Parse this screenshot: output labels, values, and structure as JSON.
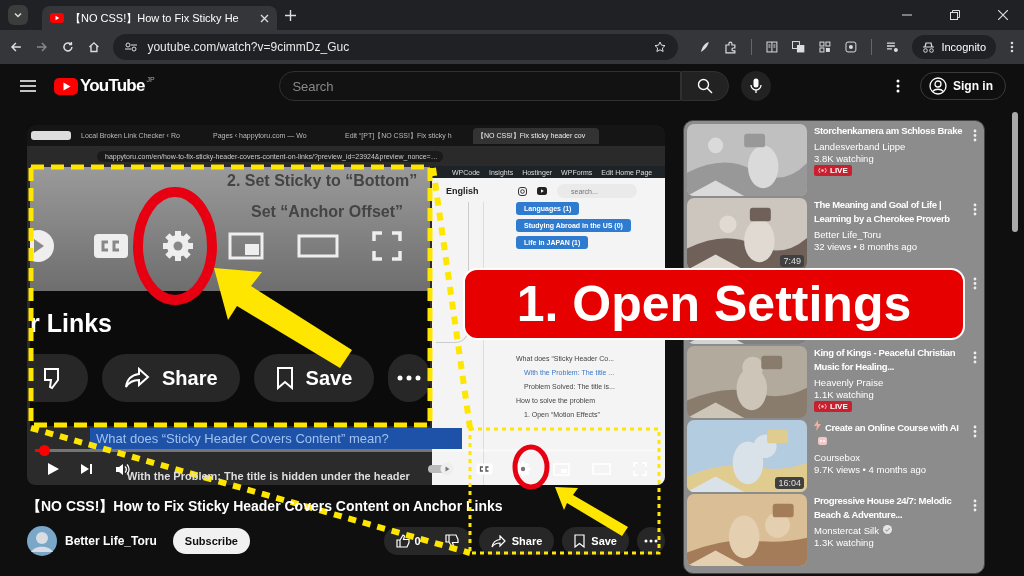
{
  "browser": {
    "tab": {
      "title": "【NO CSS!】How to Fix Sticky He",
      "selected": true
    },
    "url": "youtube.com/watch?v=9cimmDz_Guc",
    "profile": "Incognito"
  },
  "youtube": {
    "logo": "YouTube",
    "region": "JP",
    "search_placeholder": "Search",
    "sign_in": "Sign in"
  },
  "video": {
    "screen": {
      "tabs": [
        {
          "title": "Local Broken Link Checker ‹ Ro",
          "selected": false
        },
        {
          "title": "Pages ‹ happytoru.com — Wo",
          "selected": false
        },
        {
          "title": "Edit “[PT]【NO CSS!】Fix sticky h",
          "selected": false
        },
        {
          "title": "【NO CSS!】Fix sticky header cov",
          "selected": true
        }
      ],
      "url": "happytoru.com/en/how-to-fix-sticky-header-covers-content-on-links/?preview_id=23924&preview_nonce=…",
      "admin_bar": [
        "WPCode",
        "Insights",
        "Hostinger",
        "WPForms",
        "Edit Home Page"
      ],
      "language": "English",
      "search_placeholder": "search...",
      "categories": [
        "Languages (1)",
        "Studying Abroad in the US (0)",
        "Life in JAPAN (1)"
      ],
      "toc": [
        {
          "text": "What does “Sticky Header Co...",
          "highlighted": false,
          "children": [
            {
              "text": "With the Problem: The title ...",
              "highlighted": true
            },
            {
              "text": "Problem Solved: The title is...",
              "highlighted": false
            }
          ]
        },
        {
          "text": "How to solve the problem",
          "highlighted": false,
          "children": [
            {
              "text": "1. Open “Motion Effects”",
              "highlighted": false
            }
          ]
        }
      ]
    },
    "zoom": {
      "lines": [
        "2. Set Sticky to “Bottom”",
        "Set “Anchor Offset”"
      ],
      "heading": "r Links",
      "share": "Share",
      "save": "Save"
    },
    "banner": "1. Open Settings",
    "caption": "What does “Sticky Header Covers Content” mean?",
    "subline": "With the Problem: The title is hidden under the header",
    "level": 0.01
  },
  "title": "【NO CSS!】How to Fix Sticky Header Covers Content on Anchor Links",
  "channel": {
    "name": "Better Life_Toru",
    "subscribe": "Subscribe"
  },
  "actions": {
    "likes": "0",
    "share": "Share",
    "save": "Save"
  },
  "recommendations": [
    {
      "kind": "video",
      "title": "Storchenkamera am Schloss Brake",
      "channel": "Landesverband Lippe",
      "meta": "3.8K watching",
      "badge": "LIVE"
    },
    {
      "kind": "video",
      "title": "The Meaning and Goal of Life | Learning by a Cherokee Proverb",
      "channel": "Better Life_Toru",
      "meta": "32 views • 8 months ago",
      "duration": "7:49"
    },
    {
      "kind": "covered"
    },
    {
      "kind": "video",
      "title": "King of Kings - Peaceful Christian Music for Healing...",
      "channel": "Heavenly Praise",
      "meta": "1.1K watching",
      "badge": "LIVE"
    },
    {
      "kind": "video",
      "title": "Create an Online Course with AI",
      "flash_icon": true,
      "emoji_icon": true,
      "channel": "Coursebox",
      "meta": "9.7K views • 4 months ago",
      "duration": "16:04"
    },
    {
      "kind": "video",
      "title": "Progressive House 24/7: Melodic Beach & Adventure...",
      "channel": "Monstercat Silk",
      "verified": true,
      "meta": "1.3K watching"
    }
  ]
}
